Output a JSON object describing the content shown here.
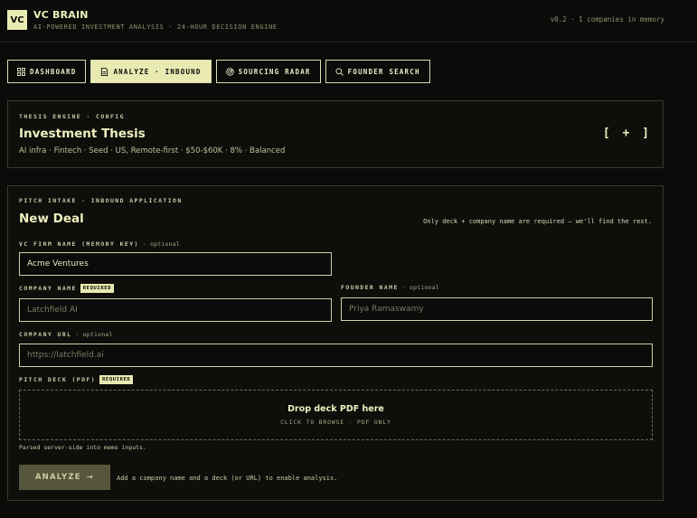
{
  "header": {
    "logo_text": "VC",
    "title": "VC BRAIN",
    "subtitle": "AI-POWERED INVESTMENT ANALYSIS · 24-HOUR DECISION ENGINE",
    "status": "v0.2 · 1 companies in memory"
  },
  "nav": {
    "items": [
      {
        "label": "DASHBOARD",
        "icon": "grid-icon",
        "active": false
      },
      {
        "label": "ANALYZE · INBOUND",
        "icon": "document-icon",
        "active": true
      },
      {
        "label": "SOURCING RADAR",
        "icon": "radar-icon",
        "active": false
      },
      {
        "label": "FOUNDER SEARCH",
        "icon": "search-icon",
        "active": false
      }
    ]
  },
  "thesis": {
    "eyebrow": "THESIS ENGINE · CONFIG",
    "title": "Investment Thesis",
    "summary": "AI infra · Fintech · Seed · US, Remote-first · $50-$60K · 8% · Balanced",
    "toggle": "[ + ]"
  },
  "deal": {
    "eyebrow": "PITCH INTAKE · INBOUND APPLICATION",
    "title": "New Deal",
    "hint": "Only deck + company name are required — we'll find the rest.",
    "vc_firm": {
      "label": "VC FIRM NAME (MEMORY KEY)",
      "note": "· optional",
      "value": "Acme Ventures"
    },
    "company_name": {
      "label": "COMPANY NAME",
      "badge": "REQUIRED",
      "placeholder": "Latchfield AI"
    },
    "founder_name": {
      "label": "FOUNDER NAME",
      "note": "· optional",
      "placeholder": "Priya Ramaswamy"
    },
    "company_url": {
      "label": "COMPANY URL",
      "note": "· optional",
      "placeholder": "https://latchfield.ai"
    },
    "pitch_deck": {
      "label": "PITCH DECK (PDF)",
      "badge": "REQUIRED"
    },
    "dropzone": {
      "title": "Drop deck PDF here",
      "subtitle": "CLICK TO BROWSE · PDF ONLY"
    },
    "parsed_note": "Parsed server-side into memo inputs.",
    "analyze_label": "ANALYZE",
    "analyze_arrow": "→",
    "analyze_hint": "Add a company name and a deck (or URL) to enable analysis."
  },
  "colors": {
    "accent": "#e8eab2",
    "background": "#0b0b09",
    "panel_border": "#3a3b2c",
    "button_disabled": "#56563d"
  }
}
